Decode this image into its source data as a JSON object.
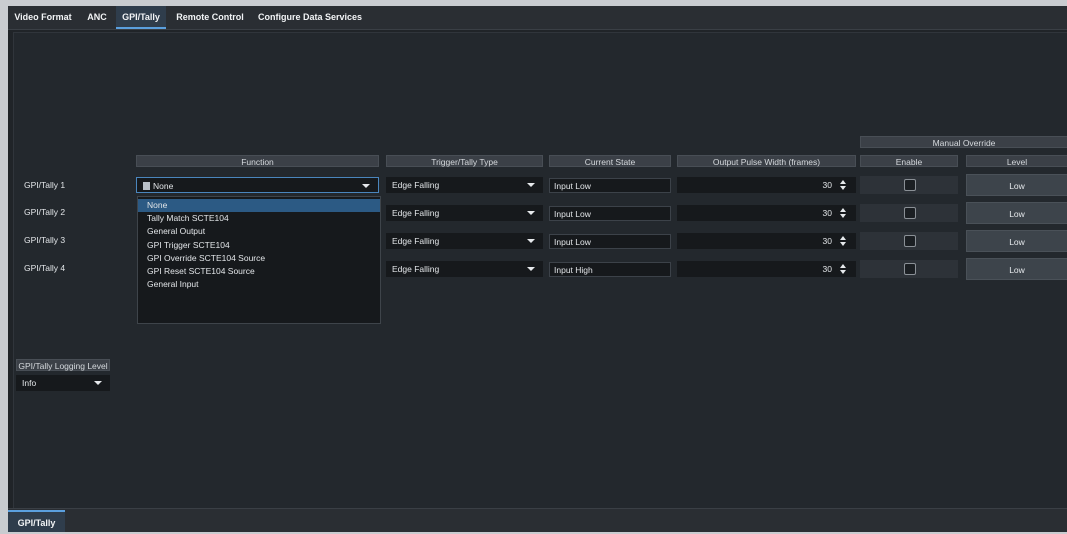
{
  "tabs": [
    {
      "label": "Video Format"
    },
    {
      "label": "ANC"
    },
    {
      "label": "GPI/Tally"
    },
    {
      "label": "Remote Control"
    },
    {
      "label": "Configure Data Services"
    }
  ],
  "selected_tab": "GPI/Tally",
  "headers": {
    "function": "Function",
    "trigger": "Trigger/Tally Type",
    "state": "Current State",
    "pulse": "Output Pulse Width (frames)",
    "manual_override": "Manual Override",
    "enable": "Enable",
    "level": "Level"
  },
  "rows": [
    {
      "label": "GPI/Tally 1",
      "function": "None",
      "trigger": "Edge Falling",
      "state": "Input Low",
      "pulse": "30",
      "enabled": false,
      "level": "Low"
    },
    {
      "label": "GPI/Tally 2",
      "function": "",
      "trigger": "Edge Falling",
      "state": "Input Low",
      "pulse": "30",
      "enabled": false,
      "level": "Low"
    },
    {
      "label": "GPI/Tally 3",
      "function": "",
      "trigger": "Edge Falling",
      "state": "Input Low",
      "pulse": "30",
      "enabled": false,
      "level": "Low"
    },
    {
      "label": "GPI/Tally 4",
      "function": "",
      "trigger": "Edge Falling",
      "state": "Input High",
      "pulse": "30",
      "enabled": false,
      "level": "Low"
    }
  ],
  "function_dropdown": {
    "options": [
      "None",
      "Tally Match SCTE104",
      "General Output",
      "GPI Trigger SCTE104",
      "GPI Override SCTE104 Source",
      "GPI Reset SCTE104 Source",
      "General Input"
    ],
    "selected": "None"
  },
  "logging": {
    "label": "GPI/Tally Logging Level",
    "value": "Info"
  },
  "bottom_tab": "GPI/Tally",
  "colors": {
    "accent": "#5ba0df",
    "background": "#202428",
    "selected_option": "#2c5a84"
  }
}
